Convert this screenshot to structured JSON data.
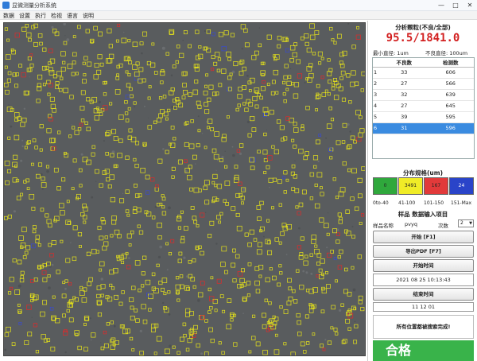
{
  "window": {
    "title": "显微测量分析系统",
    "buttons": [
      "—",
      "□",
      "✕"
    ]
  },
  "menu": [
    "数据",
    "设置",
    "执行",
    "检视",
    "语言",
    "说明"
  ],
  "panel": {
    "count_title": "分析颗粒(不良/全部)",
    "count_value": "95.5/1841.0",
    "param1_label": "最小直径: 1um",
    "param2_label": "不良直径: 100um",
    "table": {
      "headers": [
        "",
        "不良数",
        "检测数"
      ],
      "rows": [
        [
          "1",
          "33",
          "606"
        ],
        [
          "2",
          "27",
          "566"
        ],
        [
          "3",
          "32",
          "639"
        ],
        [
          "4",
          "27",
          "645"
        ],
        [
          "5",
          "39",
          "595"
        ],
        [
          "6",
          "31",
          "596"
        ]
      ],
      "selected_row": 5
    },
    "legend_title": "分布规格(um)",
    "legend": [
      {
        "label": "0",
        "color": "#2fa83c",
        "range": "0to-40"
      },
      {
        "label": "3491",
        "color": "#f0ec27",
        "range": "41-100"
      },
      {
        "label": "167",
        "color": "#e23a3a",
        "range": "101-150"
      },
      {
        "label": "24",
        "color": "#2a44c9",
        "range": "151-Max"
      }
    ],
    "spec_title": "样品 数据输入项目",
    "spec_name_label": "样品名称",
    "spec_name_value": "pvyq",
    "spec_count_label": "次数",
    "spec_count_value": "2",
    "start_button": "开始  [F1]",
    "pdf_button": "导出PDF  [F7]",
    "start_time_label": "开始时间",
    "start_time_value": "2021 08 25 10:13:43",
    "end_time_label": "结束时间",
    "end_time_value": "11 12 01",
    "status_text": "所有位置都被搜索完成!",
    "bottom_text": "合格"
  },
  "colors": {
    "particle_yellow": "#e6e31a",
    "particle_red": "#e02a2a",
    "particle_blue": "#3a4bd0"
  },
  "icons": {
    "app": "app-icon",
    "minimize": "minimize-icon",
    "maximize": "maximize-icon",
    "close": "close-icon",
    "dropdown": "chevron-down-icon"
  }
}
